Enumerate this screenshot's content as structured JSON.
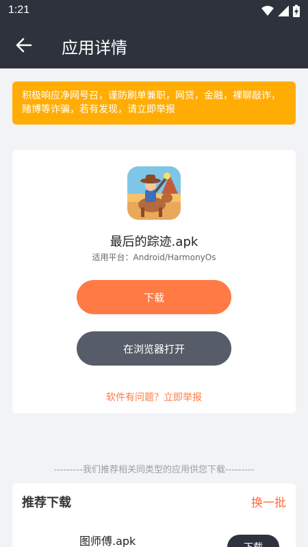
{
  "status": {
    "time": "1:21"
  },
  "appbar": {
    "title": "应用详情",
    "back_icon": "arrow-left-icon"
  },
  "notice": {
    "text": "积极响应净网号召，谨防刷单兼职，网贷，金融，裸聊敲诈，赌博等诈骗，若有发现，请立即举报"
  },
  "app": {
    "name": "最后的踪迹.apk",
    "platform": "适用平台：Android/HarmonyOs",
    "download_label": "下载",
    "browser_label": "在浏览器打开",
    "report_label": "软件有问题？立即举报"
  },
  "recommend": {
    "intro": "---------我们推荐相关同类型的应用供您下载---------",
    "title": "推荐下载",
    "refresh_label": "换一批",
    "items": [
      {
        "name": "图师傅.apk",
        "download_label": "下载"
      }
    ]
  },
  "colors": {
    "header": "#2e323d",
    "notice": "#ffad05",
    "accent": "#ff7a45",
    "secondary_button": "#565c68"
  }
}
